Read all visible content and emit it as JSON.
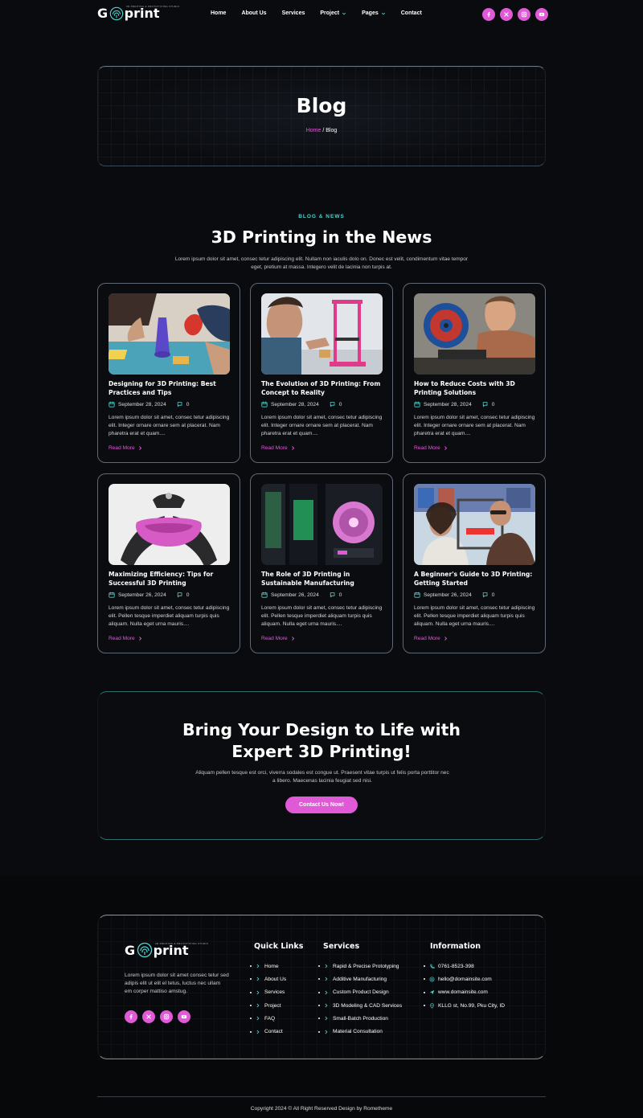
{
  "brand": {
    "logo_g": "G",
    "logo_print": "print",
    "tagline": "3D PRINTING & PROTOTYPING STUDIO"
  },
  "nav": {
    "items": [
      {
        "label": "Home",
        "dropdown": false
      },
      {
        "label": "About Us",
        "dropdown": false
      },
      {
        "label": "Services",
        "dropdown": false
      },
      {
        "label": "Project",
        "dropdown": true
      },
      {
        "label": "Pages",
        "dropdown": true
      },
      {
        "label": "Contact",
        "dropdown": false
      }
    ],
    "socials": [
      "facebook-icon",
      "x-icon",
      "instagram-icon",
      "youtube-icon"
    ]
  },
  "hero": {
    "title": "Blog",
    "crumb_home": "Home",
    "crumb_sep": " / ",
    "crumb_current": "Blog"
  },
  "blog": {
    "eyebrow": "BLOG & NEWS",
    "title": "3D Printing in the News",
    "description": "Lorem ipsum dolor sit amet, consec tetur adipiscing elit. Nullam non iaculis dolo on. Donec est velit, condimentum vitae tempor eget, pretium at massa. Integero velit de lacinia non turpis at.",
    "read_more": "Read More",
    "posts": [
      {
        "title": "Designing for 3D Printing: Best Practices and Tips",
        "date": "September 28, 2024",
        "comments": "0",
        "excerpt": "Lorem ipsum dolor sit amet, consec tetur adipiscing elit. Integer ornare ornare sem at placerat. Nam pharetra erat et quam...."
      },
      {
        "title": "The Evolution of 3D Printing: From Concept to Reality",
        "date": "September 28, 2024",
        "comments": "0",
        "excerpt": "Lorem ipsum dolor sit amet, consec tetur adipiscing elit. Integer ornare ornare sem at placerat. Nam pharetra erat et quam...."
      },
      {
        "title": "How to Reduce Costs with 3D Printing Solutions",
        "date": "September 28, 2024",
        "comments": "0",
        "excerpt": "Lorem ipsum dolor sit amet, consec tetur adipiscing elit. Integer ornare ornare sem at placerat. Nam pharetra erat et quam...."
      },
      {
        "title": "Maximizing Efficiency: Tips for Successful 3D Printing",
        "date": "September 26, 2024",
        "comments": "0",
        "excerpt": "Lorem ipsum dolor sit amet, consec tetur adipiscing elit. Pellen tesque imperdiet aliquam turpis quis aliquam. Nulla eget urna mauris...."
      },
      {
        "title": "The Role of 3D Printing in Sustainable Manufacturing",
        "date": "September 26, 2024",
        "comments": "0",
        "excerpt": "Lorem ipsum dolor sit amet, consec tetur adipiscing elit. Pellen tesque imperdiet aliquam turpis quis aliquam. Nulla eget urna mauris...."
      },
      {
        "title": "A Beginner's Guide to 3D Printing: Getting Started",
        "date": "September 26, 2024",
        "comments": "0",
        "excerpt": "Lorem ipsum dolor sit amet, consec tetur adipiscing elit. Pellen tesque imperdiet aliquam turpis quis aliquam. Nulla eget urna mauris...."
      }
    ]
  },
  "cta": {
    "title_line1": "Bring Your Design to Life with",
    "title_line2": "Expert 3D Printing!",
    "description": "Aliquam pellen tesque est orci, viverra sodales est congue ut. Praesent vitae turpis ut felis porta porttitor nec a libero. Maecenas lacinia feugiat sed nisi.",
    "button": "Contact Us Now!"
  },
  "footer": {
    "about": "Lorem ipsum dolor sit amet consec tetur sed adipis elit ut elit el tetus, luctus nec ullam em corper mattiso amstug.",
    "quick_links_title": "Quick Links",
    "quick_links": [
      "Home",
      "About Us",
      "Services",
      "Project",
      "FAQ",
      "Contact"
    ],
    "services_title": "Services",
    "services": [
      "Rapid & Precise Prototyping",
      "Additive Manufacturing",
      "Custom Product Design",
      "3D Modeling & CAD Services",
      "Small-Batch Production",
      "Material Consultation"
    ],
    "info_title": "Information",
    "info": [
      {
        "icon": "phone-icon",
        "text": "0761-8523-398"
      },
      {
        "icon": "mail-icon",
        "text": "hello@domainsite.com"
      },
      {
        "icon": "send-icon",
        "text": "www.domainsite.com"
      },
      {
        "icon": "location-icon",
        "text": "KLLG st, No.99, Pku City, ID"
      }
    ],
    "copyright": "Copyright 2024 © All Right Reserved Design by Rometheme"
  },
  "colors": {
    "accent_pink": "#e05ad7",
    "accent_teal": "#4fd3d0",
    "background": "#090b0f"
  }
}
